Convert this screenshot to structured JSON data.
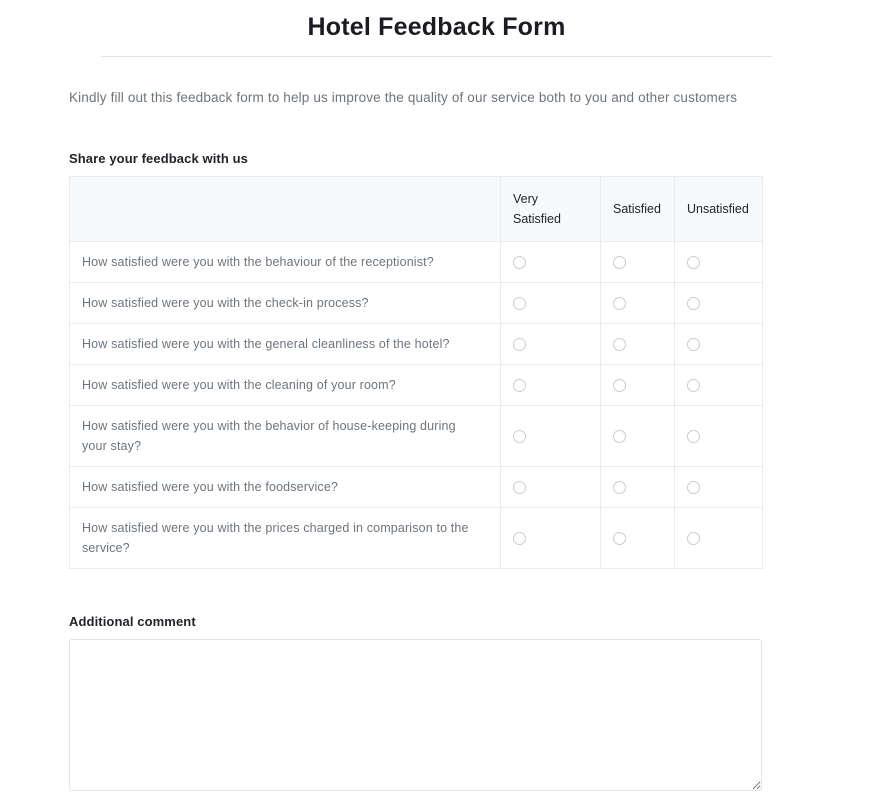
{
  "form": {
    "title": "Hotel Feedback Form",
    "intro": "Kindly fill out this feedback form to help us improve the quality of our service both to you and other customers",
    "section_label": "Share your feedback with us",
    "comment_label": "Additional comment",
    "comment_value": "",
    "comment_placeholder": ""
  },
  "matrix": {
    "header": {
      "question_column": "",
      "options": [
        "Very Satisfied",
        "Satisfied",
        "Unsatisfied"
      ]
    },
    "rows": [
      {
        "question": "How satisfied were you with the behaviour of the receptionist?"
      },
      {
        "question": "How satisfied were you with the check-in process?"
      },
      {
        "question": "How satisfied were you with the general cleanliness of the hotel?"
      },
      {
        "question": "How satisfied were you with the cleaning of your room?"
      },
      {
        "question": "How satisfied were you with the behavior of house-keeping during your stay?"
      },
      {
        "question": "How satisfied were you with the foodservice?"
      },
      {
        "question": "How satisfied were you with the prices charged in comparison to the service?"
      }
    ],
    "selected": [
      null,
      null,
      null,
      null,
      null,
      null,
      null
    ]
  },
  "colors": {
    "page_background": "#ffffff",
    "title_text": "#1b1b22",
    "body_text": "#6c757d",
    "label_text": "#212529",
    "table_border": "#e9ecef",
    "header_background": "#f8f9fa",
    "radio_border": "#c9ccd1",
    "rule": "#e3e3e6",
    "textarea_border": "#e3e4e8"
  }
}
